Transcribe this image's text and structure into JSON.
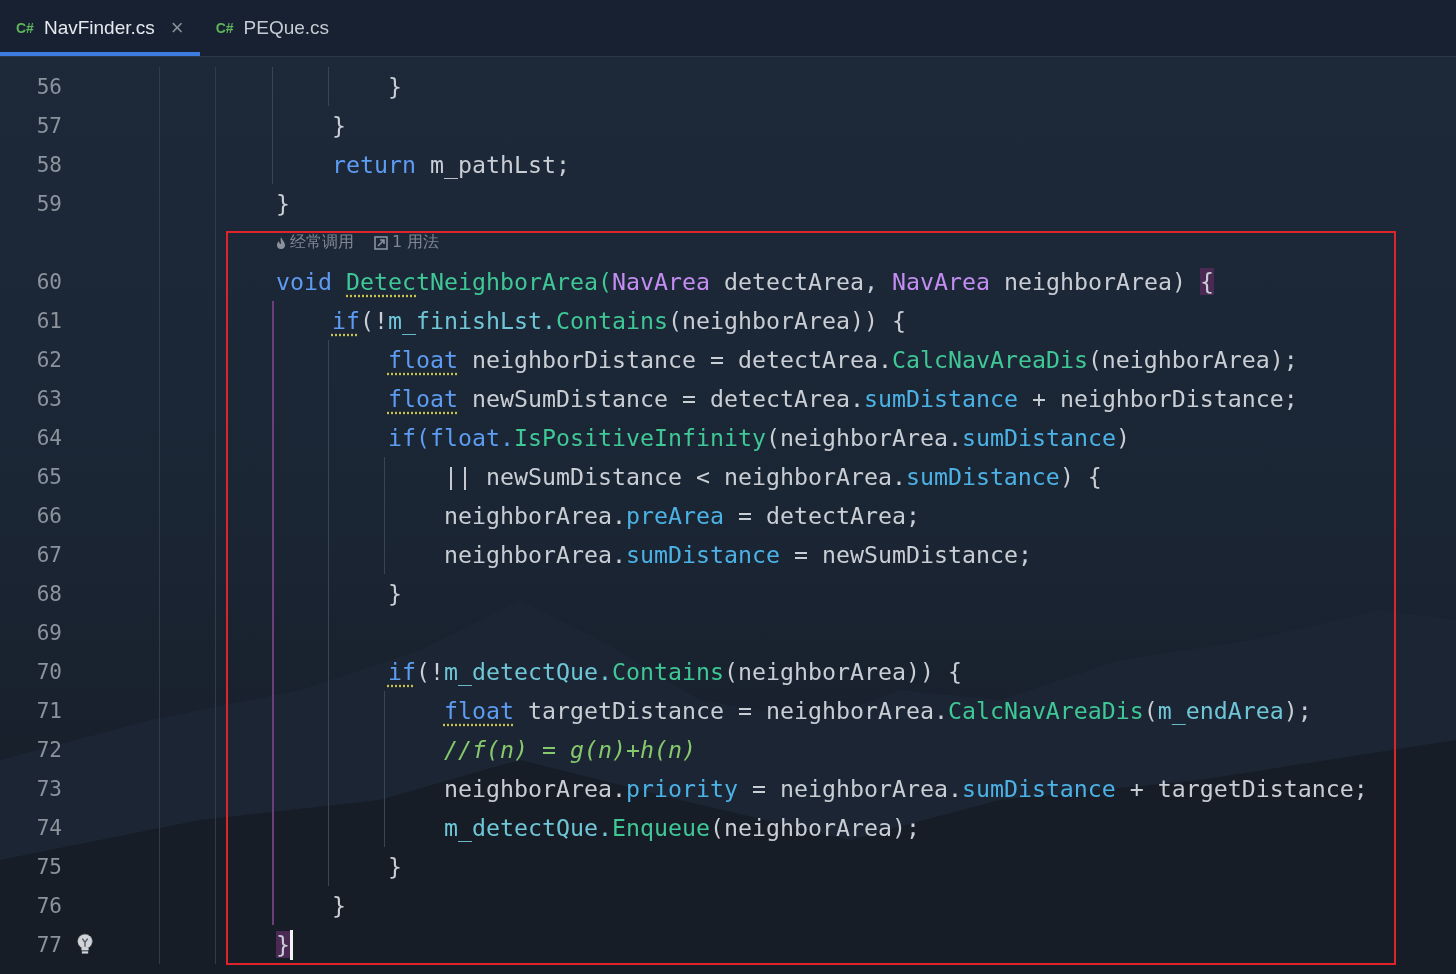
{
  "tabs": [
    {
      "lang": "C#",
      "name": "NavFinder.cs",
      "selected": true,
      "closable": true
    },
    {
      "lang": "C#",
      "name": "PEQue.cs",
      "selected": false,
      "closable": false
    }
  ],
  "close_glyph": "×",
  "lines": [
    {
      "children": [
        {
          "children": [
            {
              "number": "56",
              "tokens": [
                {
                  "t": "}",
                  "kind": "plain"
                }
              ]
            }
          ]
        },
        {
          "number": "57",
          "tokens": [
            {
              "t": "}",
              "kind": "plain"
            }
          ]
        },
        {
          "number": "58",
          "tokens": [
            {
              "t": "return ",
              "kind": "kw"
            },
            {
              "t": "m_pathLst;",
              "kind": "plain"
            }
          ]
        }
      ]
    },
    {
      "number": "59",
      "tokens": [
        {
          "t": "}",
          "kind": "plain"
        }
      ]
    },
    {
      "kind": "hint",
      "items": [
        {
          "text": "经常调用"
        },
        {
          "text": "1 用法"
        }
      ]
    },
    {
      "number": "60",
      "tokens": [
        {
          "t": "void ",
          "kind": "kw"
        },
        {
          "t": "Detec",
          "kind": "fn",
          "warn": true
        },
        {
          "t": "tNeighborArea(",
          "kind": "fn"
        },
        {
          "t": "NavArea",
          "kind": "type"
        },
        {
          "t": " detectArea, ",
          "kind": "plain"
        },
        {
          "t": "NavArea",
          "kind": "type"
        },
        {
          "t": " neighborArea) ",
          "kind": "plain"
        },
        {
          "t": "{",
          "kind": "plain",
          "match": true
        }
      ],
      "children": [
        {
          "number": "61",
          "tokens": [
            {
              "t": "if",
              "kind": "kw",
              "warn": true
            },
            {
              "t": "(!",
              "kind": "plain"
            },
            {
              "t": "m_finishLst.",
              "kind": "field"
            },
            {
              "t": "Contains",
              "kind": "fn"
            },
            {
              "t": "(neighborArea)) {",
              "kind": "plain"
            }
          ],
          "children": [
            {
              "number": "62",
              "tokens": [
                {
                  "t": "float",
                  "kind": "kw",
                  "warn": true
                },
                {
                  "t": " neighborDistance = detectArea.",
                  "kind": "plain"
                },
                {
                  "t": "CalcNavAreaDis",
                  "kind": "fn"
                },
                {
                  "t": "(neighborArea);",
                  "kind": "plain"
                }
              ]
            },
            {
              "number": "63",
              "tokens": [
                {
                  "t": "float",
                  "kind": "kw",
                  "warn": true
                },
                {
                  "t": " newSumDistance = detectArea.",
                  "kind": "plain"
                },
                {
                  "t": "sumDistance",
                  "kind": "prop"
                },
                {
                  "t": " + neighborDistance;",
                  "kind": "plain"
                }
              ]
            },
            {
              "number": "64",
              "tokens": [
                {
                  "t": "if(",
                  "kind": "kw"
                },
                {
                  "t": "float.",
                  "kind": "kw"
                },
                {
                  "t": "IsPositiveInfinity",
                  "kind": "fn"
                },
                {
                  "t": "(neighborArea.",
                  "kind": "plain"
                },
                {
                  "t": "sumDistance",
                  "kind": "prop"
                },
                {
                  "t": ")",
                  "kind": "plain"
                }
              ],
              "children": [
                {
                  "number": "65",
                  "tokens": [
                    {
                      "t": "|| newSumDistance < neighborArea.",
                      "kind": "plain"
                    },
                    {
                      "t": "sumDistance",
                      "kind": "prop"
                    },
                    {
                      "t": ") {",
                      "kind": "plain"
                    }
                  ]
                },
                {
                  "number": "66",
                  "tokens": [
                    {
                      "t": "neighborArea.",
                      "kind": "plain"
                    },
                    {
                      "t": "preArea",
                      "kind": "prop"
                    },
                    {
                      "t": " = detectArea;",
                      "kind": "plain"
                    }
                  ]
                },
                {
                  "number": "67",
                  "tokens": [
                    {
                      "t": "neighborArea.",
                      "kind": "plain"
                    },
                    {
                      "t": "sumDistance",
                      "kind": "prop"
                    },
                    {
                      "t": " = newSumDistance;",
                      "kind": "plain"
                    }
                  ]
                }
              ]
            },
            {
              "number": "68",
              "tokens": [
                {
                  "t": "}",
                  "kind": "plain"
                }
              ]
            },
            {
              "number": "69"
            },
            {
              "number": "70",
              "tokens": [
                {
                  "t": "if",
                  "kind": "kw",
                  "warn": true
                },
                {
                  "t": "(!",
                  "kind": "plain"
                },
                {
                  "t": "m_detectQue.",
                  "kind": "field"
                },
                {
                  "t": "Contains",
                  "kind": "fn"
                },
                {
                  "t": "(neighborArea)) {",
                  "kind": "plain"
                }
              ],
              "children": [
                {
                  "number": "71",
                  "tokens": [
                    {
                      "t": "float",
                      "kind": "kw",
                      "warn": true
                    },
                    {
                      "t": " targetDistance = neighborArea.",
                      "kind": "plain"
                    },
                    {
                      "t": "CalcNavAreaDis",
                      "kind": "fn"
                    },
                    {
                      "t": "(",
                      "kind": "plain"
                    },
                    {
                      "t": "m_endArea",
                      "kind": "field"
                    },
                    {
                      "t": ");",
                      "kind": "plain"
                    }
                  ]
                },
                {
                  "number": "72",
                  "tokens": [
                    {
                      "t": "//f(n) = g(n)+h(n)",
                      "kind": "comment"
                    }
                  ]
                },
                {
                  "number": "73",
                  "tokens": [
                    {
                      "t": "neighborArea.",
                      "kind": "plain"
                    },
                    {
                      "t": "priority",
                      "kind": "prop"
                    },
                    {
                      "t": " = neighborArea.",
                      "kind": "plain"
                    },
                    {
                      "t": "sumDistance",
                      "kind": "prop"
                    },
                    {
                      "t": " + targetDistance;",
                      "kind": "plain"
                    }
                  ]
                },
                {
                  "number": "74",
                  "tokens": [
                    {
                      "t": "m_detectQue.",
                      "kind": "field"
                    },
                    {
                      "t": "Enqueue",
                      "kind": "fn"
                    },
                    {
                      "t": "(neighborArea);",
                      "kind": "plain"
                    }
                  ]
                }
              ]
            },
            {
              "number": "75",
              "tokens": [
                {
                  "t": "}",
                  "kind": "plain"
                }
              ]
            }
          ]
        },
        {
          "number": "76",
          "tokens": [
            {
              "t": "}",
              "kind": "plain"
            }
          ]
        }
      ]
    },
    {
      "number": "77",
      "bulb": true,
      "cursor": true,
      "tokens": [
        {
          "t": "}",
          "kind": "plain",
          "match": true
        }
      ]
    }
  ]
}
